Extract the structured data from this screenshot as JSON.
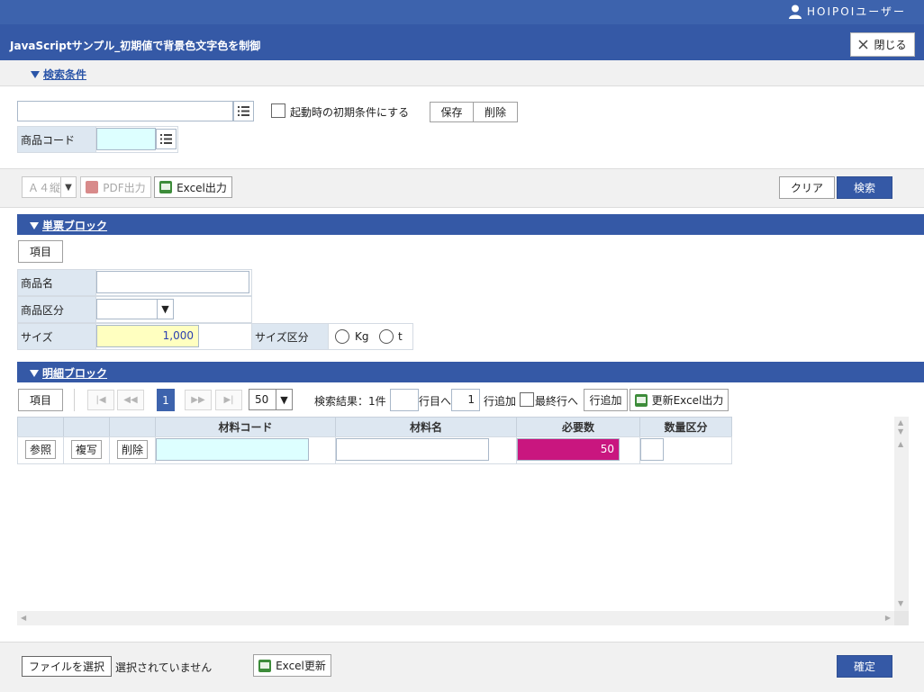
{
  "header": {
    "user_name": "HOIPOIユーザー",
    "title": "JavaScriptサンプル_初期値で背景色文字色を制御",
    "close_label": "閉じる"
  },
  "search": {
    "section_label": "検索条件",
    "condition_input_value": "",
    "startup_checkbox_label": "起動時の初期条件にする",
    "save_label": "保存",
    "delete_label": "削除",
    "product_code_label": "商品コード",
    "product_code_value": ""
  },
  "toolbar": {
    "paper_select": "Ａ４縦",
    "pdf_label": "PDF出力",
    "excel_label": "Excel出力",
    "clear_label": "クリア",
    "search_label": "検索"
  },
  "single_block": {
    "title": "単票ブロック",
    "item_button": "項目",
    "product_name_label": "商品名",
    "product_name_value": "",
    "product_category_label": "商品区分",
    "product_category_value": "",
    "size_label": "サイズ",
    "size_value": "1,000",
    "size_unit_label": "サイズ区分",
    "unit_options": [
      "Kg",
      "t"
    ]
  },
  "detail_block": {
    "title": "明細ブロック",
    "item_button": "項目",
    "current_page": "1",
    "page_size": "50",
    "result_label": "検索結果：1件",
    "goto_value": "",
    "goto_suffix": "行目へ",
    "add_count": "1",
    "add_label": "行追加",
    "last_row_label": "最終行へ",
    "add_row_button": "行追加",
    "update_excel_label": "更新Excel出力",
    "columns": [
      "材料コード",
      "材料名",
      "必要数",
      "数量区分"
    ],
    "rows": [
      {
        "ref_label": "参照",
        "copy_label": "複写",
        "delete_label": "削除",
        "material_code": "",
        "material_name": "",
        "required_qty": "50",
        "qty_unit": ""
      }
    ]
  },
  "footer": {
    "file_button": "ファイルを選択",
    "file_status": "選択されていません",
    "excel_update_label": "Excel更新",
    "confirm_label": "確定"
  },
  "colors": {
    "header_blue": "#3559a6",
    "cyan_field": "#ddffff",
    "yellow_field": "#ffffc0",
    "magenta_field": "#c9167f"
  }
}
